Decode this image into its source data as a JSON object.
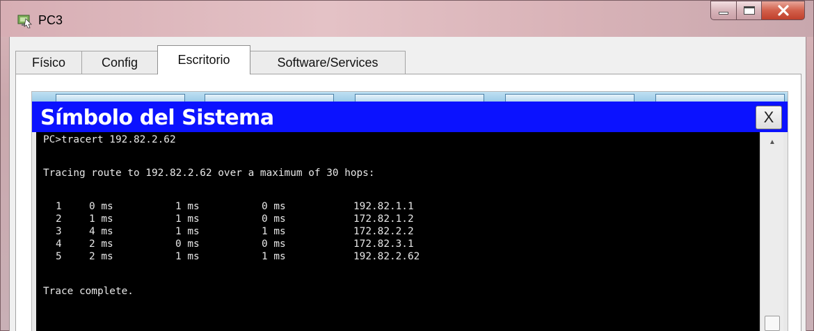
{
  "window": {
    "title": "PC3",
    "icon": "packet-tracer-pc-icon",
    "buttons": {
      "minimize": "minimize-icon",
      "maximize": "maximize-icon",
      "close": "X"
    }
  },
  "tabs": [
    {
      "label": "Físico",
      "active": false
    },
    {
      "label": "Config",
      "active": false
    },
    {
      "label": "Escritorio",
      "active": true
    },
    {
      "label": "Software/Services",
      "active": false
    }
  ],
  "command_prompt": {
    "title": "Símbolo del Sistema",
    "close_label": "X",
    "command_line": "PC>tracert 192.82.2.62",
    "tracing_header": "Tracing route to 192.82.2.62 over a maximum of 30 hops:",
    "hops": [
      {
        "hop": "1",
        "rtt1": "0 ms",
        "rtt2": "1 ms",
        "rtt3": "0 ms",
        "address": "192.82.1.1"
      },
      {
        "hop": "2",
        "rtt1": "1 ms",
        "rtt2": "1 ms",
        "rtt3": "0 ms",
        "address": "172.82.1.2"
      },
      {
        "hop": "3",
        "rtt1": "4 ms",
        "rtt2": "1 ms",
        "rtt3": "1 ms",
        "address": "172.82.2.2"
      },
      {
        "hop": "4",
        "rtt1": "2 ms",
        "rtt2": "0 ms",
        "rtt3": "0 ms",
        "address": "172.82.3.1"
      },
      {
        "hop": "5",
        "rtt1": "2 ms",
        "rtt2": "1 ms",
        "rtt3": "1 ms",
        "address": "192.82.2.62"
      }
    ],
    "footer": "Trace complete."
  },
  "colors": {
    "cmd_titlebar": "#0b12ff",
    "terminal_bg": "#000000",
    "terminal_text": "#e8e8e8",
    "close_button": "#c0402c"
  }
}
